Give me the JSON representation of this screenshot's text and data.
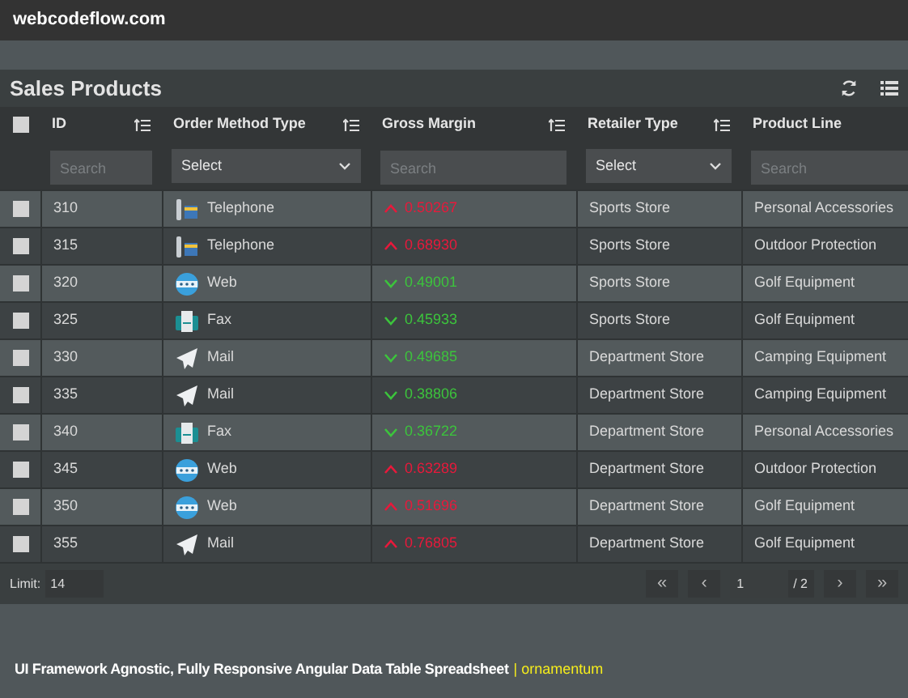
{
  "site": {
    "title": "webcodeflow.com"
  },
  "panel": {
    "title": "Sales Products"
  },
  "columns": [
    {
      "label": "ID",
      "sortable": true,
      "filter": {
        "kind": "search",
        "placeholder": "Search"
      }
    },
    {
      "label": "Order Method Type",
      "sortable": true,
      "filter": {
        "kind": "select",
        "value": "Select"
      }
    },
    {
      "label": "Gross Margin",
      "sortable": true,
      "filter": {
        "kind": "search",
        "placeholder": "Search"
      }
    },
    {
      "label": "Retailer Type",
      "sortable": true,
      "filter": {
        "kind": "select",
        "value": "Select"
      }
    },
    {
      "label": "Product Line",
      "sortable": false,
      "filter": {
        "kind": "search",
        "placeholder": "Search"
      }
    }
  ],
  "select_all": {
    "checked": false
  },
  "rows": [
    {
      "checked": false,
      "id": "310",
      "method": {
        "kind": "telephone",
        "label": "Telephone"
      },
      "margin": {
        "rising": true,
        "value": "0.50267"
      },
      "retailer": "Sports Store",
      "product_line": "Personal Accessories"
    },
    {
      "checked": false,
      "id": "315",
      "method": {
        "kind": "telephone",
        "label": "Telephone"
      },
      "margin": {
        "rising": true,
        "value": "0.68930"
      },
      "retailer": "Sports Store",
      "product_line": "Outdoor Protection"
    },
    {
      "checked": false,
      "id": "320",
      "method": {
        "kind": "web",
        "label": "Web"
      },
      "margin": {
        "rising": false,
        "value": "0.49001"
      },
      "retailer": "Sports Store",
      "product_line": "Golf Equipment"
    },
    {
      "checked": false,
      "id": "325",
      "method": {
        "kind": "fax",
        "label": "Fax"
      },
      "margin": {
        "rising": false,
        "value": "0.45933"
      },
      "retailer": "Sports Store",
      "product_line": "Golf Equipment"
    },
    {
      "checked": false,
      "id": "330",
      "method": {
        "kind": "mail",
        "label": "Mail"
      },
      "margin": {
        "rising": false,
        "value": "0.49685"
      },
      "retailer": "Department Store",
      "product_line": "Camping Equipment"
    },
    {
      "checked": false,
      "id": "335",
      "method": {
        "kind": "mail",
        "label": "Mail"
      },
      "margin": {
        "rising": false,
        "value": "0.38806"
      },
      "retailer": "Department Store",
      "product_line": "Camping Equipment"
    },
    {
      "checked": false,
      "id": "340",
      "method": {
        "kind": "fax",
        "label": "Fax"
      },
      "margin": {
        "rising": false,
        "value": "0.36722"
      },
      "retailer": "Department Store",
      "product_line": "Personal Accessories"
    },
    {
      "checked": false,
      "id": "345",
      "method": {
        "kind": "web",
        "label": "Web"
      },
      "margin": {
        "rising": true,
        "value": "0.63289"
      },
      "retailer": "Department Store",
      "product_line": "Outdoor Protection"
    },
    {
      "checked": false,
      "id": "350",
      "method": {
        "kind": "web",
        "label": "Web"
      },
      "margin": {
        "rising": true,
        "value": "0.51696"
      },
      "retailer": "Department Store",
      "product_line": "Golf Equipment"
    },
    {
      "checked": false,
      "id": "355",
      "method": {
        "kind": "mail",
        "label": "Mail"
      },
      "margin": {
        "rising": true,
        "value": "0.76805"
      },
      "retailer": "Department Store",
      "product_line": "Golf Equipment"
    }
  ],
  "footer": {
    "limit_label": "Limit:",
    "limit": "14",
    "first": "«",
    "prev": "‹",
    "page": "1",
    "page_total": "/ 2",
    "next": "›",
    "last": "»"
  },
  "caption": {
    "text": "UI Framework Agnostic, Fully Responsive Angular Data Table Spreadsheet",
    "link": "| ornamentum"
  }
}
